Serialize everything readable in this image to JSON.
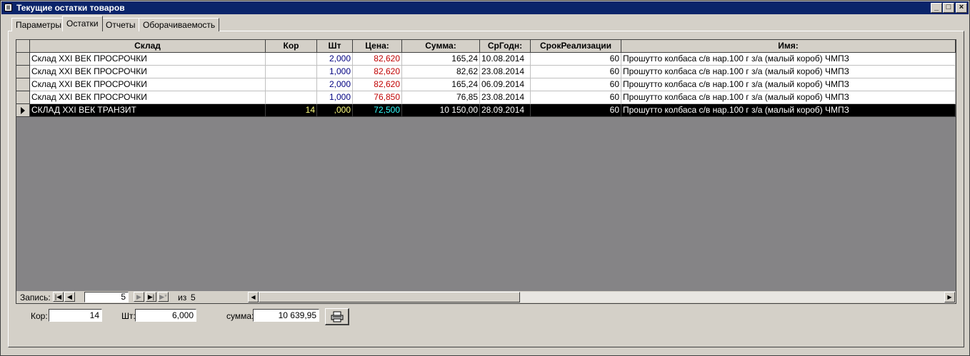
{
  "window": {
    "title": "Текущие остатки товаров"
  },
  "tabs": [
    {
      "label": "Параметры"
    },
    {
      "label": "Остатки"
    },
    {
      "label": "Отчеты"
    },
    {
      "label": "Оборачиваемость"
    }
  ],
  "grid": {
    "columns": [
      "Склад",
      "Кор",
      "Шт",
      "Цена:",
      "Сумма:",
      "СрГодн:",
      "СрокРеализации",
      "Имя:"
    ],
    "rows": [
      {
        "sklad": "Склад XXI ВЕК ПРОСРОЧКИ",
        "kor": "",
        "sht": "2,000",
        "price": "82,620",
        "sum": "165,24",
        "srgodn": "10.08.2014",
        "srok": "60",
        "name": "Прошутто колбаса с/в нар.100 г з/а (малый короб) ЧМПЗ"
      },
      {
        "sklad": "Склад XXI ВЕК ПРОСРОЧКИ",
        "kor": "",
        "sht": "1,000",
        "price": "82,620",
        "sum": "82,62",
        "srgodn": "23.08.2014",
        "srok": "60",
        "name": "Прошутто колбаса с/в нар.100 г з/а (малый короб) ЧМПЗ"
      },
      {
        "sklad": "Склад XXI ВЕК ПРОСРОЧКИ",
        "kor": "",
        "sht": "2,000",
        "price": "82,620",
        "sum": "165,24",
        "srgodn": "06.09.2014",
        "srok": "60",
        "name": "Прошутто колбаса с/в нар.100 г з/а (малый короб) ЧМПЗ"
      },
      {
        "sklad": "Склад XXI ВЕК ПРОСРОЧКИ",
        "kor": "",
        "sht": "1,000",
        "price": "76,850",
        "sum": "76,85",
        "srgodn": "23.08.2014",
        "srok": "60",
        "name": "Прошутто колбаса с/в нар.100 г з/а (малый короб) ЧМПЗ"
      },
      {
        "sklad": "СКЛАД XXI ВЕК ТРАНЗИТ",
        "kor": "14",
        "sht": ",000",
        "price": "72,500",
        "sum": "10 150,00",
        "srgodn": "28.09.2014",
        "srok": "60",
        "name": "Прошутто колбаса с/в нар.100 г з/а (малый короб) ЧМПЗ"
      }
    ]
  },
  "navigator": {
    "label": "Запись:",
    "current": "5",
    "of_label": "из",
    "total": "5"
  },
  "summary": {
    "kor_label": "Кор:",
    "kor_value": "14",
    "sht_label": "Шт:",
    "sht_value": "6,000",
    "sum_label": "сумма:",
    "sum_value": "10 639,95"
  },
  "colors": {
    "titlebar": "#0a246a",
    "grid_bg": "#858486",
    "price": "#c00000",
    "qty": "#000080"
  }
}
